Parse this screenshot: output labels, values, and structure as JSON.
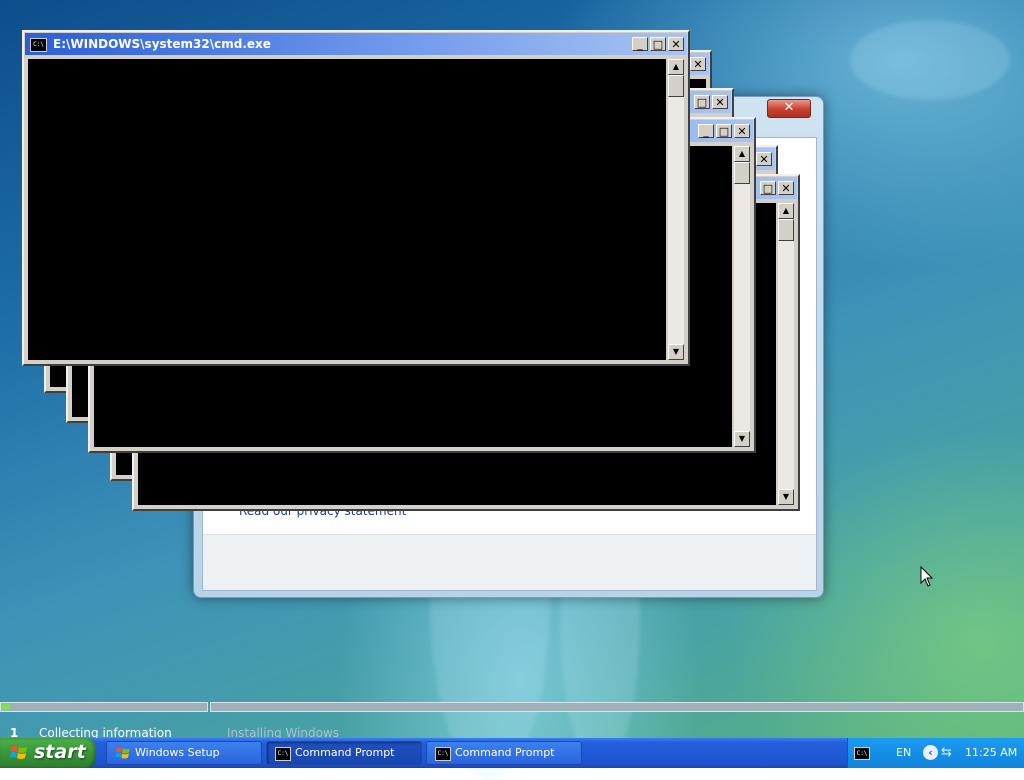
{
  "setup_dialog": {
    "privacy_link": "Read our privacy statement",
    "close_glyph": "✕"
  },
  "cmd_windows": {
    "front_title": "E:\\WINDOWS\\system32\\cmd.exe",
    "icon_text": "C:\\",
    "minimize_glyph": "_",
    "maximize_glyph": "□",
    "close_glyph": "✕",
    "scroll_up_glyph": "▲",
    "scroll_down_glyph": "▼"
  },
  "setup_progress": {
    "step1": "Collecting information",
    "step2": "Installing Windows",
    "step1_marker": "1",
    "progress_fraction": 0.01
  },
  "taskbar": {
    "start_label": "start",
    "items": [
      {
        "label": "Windows Setup"
      },
      {
        "label": "Command Prompt"
      },
      {
        "label": "Command Prompt"
      }
    ],
    "tray": {
      "language": "EN",
      "clock": "11:25 AM",
      "chevron_glyph": "‹",
      "network_glyph": "⇆"
    }
  },
  "colors": {
    "titlebar": "#2a5fd6",
    "console": "#000000",
    "taskbar": "#2460dc",
    "start_button": "#3a963a"
  }
}
